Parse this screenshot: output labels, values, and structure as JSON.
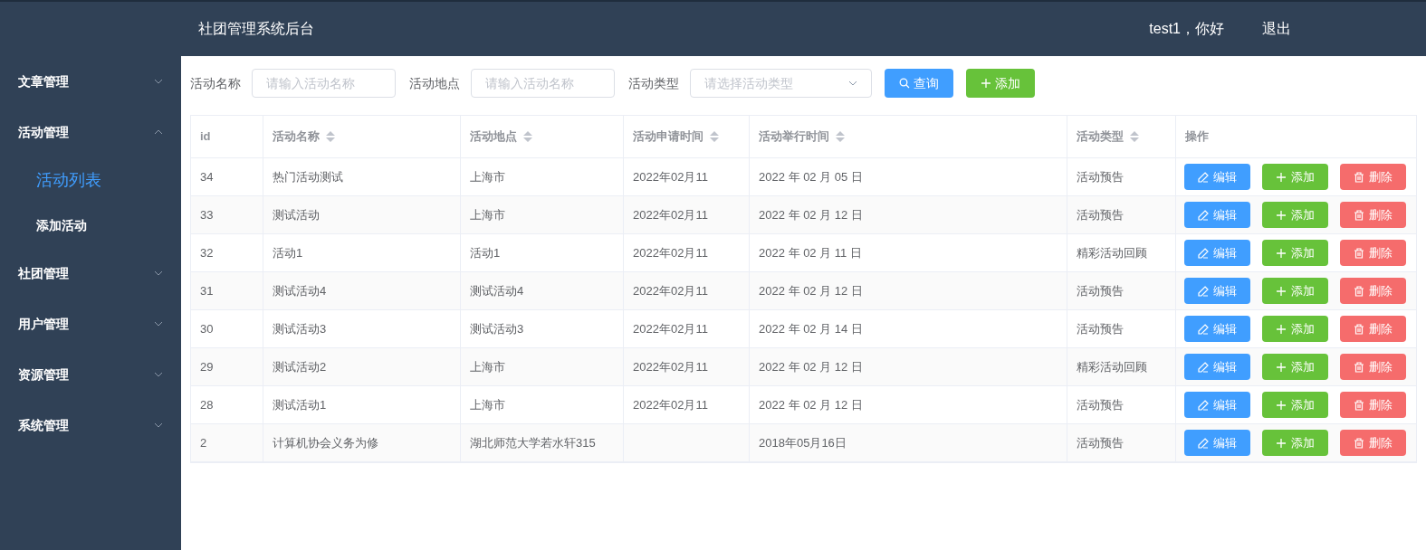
{
  "header": {
    "title": "社团管理系统后台",
    "greeting": "test1，你好",
    "logout": "退出"
  },
  "sidebar": {
    "items": [
      {
        "label": "文章管理",
        "expanded": false
      },
      {
        "label": "活动管理",
        "expanded": true,
        "children": [
          {
            "label": "活动列表",
            "selected": true
          },
          {
            "label": "添加活动",
            "selected": false
          }
        ]
      },
      {
        "label": "社团管理",
        "expanded": false
      },
      {
        "label": "用户管理",
        "expanded": false
      },
      {
        "label": "资源管理",
        "expanded": false
      },
      {
        "label": "系统管理",
        "expanded": false
      }
    ]
  },
  "filters": [
    {
      "kind": "input",
      "label": "活动名称",
      "placeholder": "请输入活动名称"
    },
    {
      "kind": "input",
      "label": "活动地点",
      "placeholder": "请输入活动名称"
    },
    {
      "kind": "select",
      "label": "活动类型",
      "placeholder": "请选择活动类型"
    }
  ],
  "toolbar_buttons": [
    {
      "kind": "search",
      "label": "查询"
    },
    {
      "kind": "add",
      "label": "添加"
    }
  ],
  "table": {
    "columns": [
      {
        "label": "id",
        "sortable": false
      },
      {
        "label": "活动名称",
        "sortable": true
      },
      {
        "label": "活动地点",
        "sortable": true
      },
      {
        "label": "活动申请时间",
        "sortable": true
      },
      {
        "label": "活动举行时间",
        "sortable": true
      },
      {
        "label": "活动类型",
        "sortable": true
      },
      {
        "label": "操作",
        "sortable": false
      }
    ],
    "rows": [
      {
        "cells": [
          "34",
          "热门活动测试",
          "上海市",
          "2022年02月11",
          "2022 年 02 月 05 日",
          "活动预告"
        ],
        "actions": [
          {
            "kind": "edit",
            "label": "编辑"
          },
          {
            "kind": "add",
            "label": "添加"
          },
          {
            "kind": "delete",
            "label": "删除"
          }
        ]
      },
      {
        "cells": [
          "33",
          "测试活动",
          "上海市",
          "2022年02月11",
          "2022 年 02 月 12 日",
          "活动预告"
        ],
        "actions": [
          {
            "kind": "edit",
            "label": "编辑"
          },
          {
            "kind": "add",
            "label": "添加"
          },
          {
            "kind": "delete",
            "label": "删除"
          }
        ]
      },
      {
        "cells": [
          "32",
          "活动1",
          "活动1",
          "2022年02月11",
          "2022 年 02 月 11 日",
          "精彩活动回顾"
        ],
        "actions": [
          {
            "kind": "edit",
            "label": "编辑"
          },
          {
            "kind": "add",
            "label": "添加"
          },
          {
            "kind": "delete",
            "label": "删除"
          }
        ]
      },
      {
        "cells": [
          "31",
          "测试活动4",
          "测试活动4",
          "2022年02月11",
          "2022 年 02 月 12 日",
          "活动预告"
        ],
        "actions": [
          {
            "kind": "edit",
            "label": "编辑"
          },
          {
            "kind": "add",
            "label": "添加"
          },
          {
            "kind": "delete",
            "label": "删除"
          }
        ]
      },
      {
        "cells": [
          "30",
          "测试活动3",
          "测试活动3",
          "2022年02月11",
          "2022 年 02 月 14 日",
          "活动预告"
        ],
        "actions": [
          {
            "kind": "edit",
            "label": "编辑"
          },
          {
            "kind": "add",
            "label": "添加"
          },
          {
            "kind": "delete",
            "label": "删除"
          }
        ]
      },
      {
        "cells": [
          "29",
          "测试活动2",
          "上海市",
          "2022年02月11",
          "2022 年 02 月 12 日",
          "精彩活动回顾"
        ],
        "actions": [
          {
            "kind": "edit",
            "label": "编辑"
          },
          {
            "kind": "add",
            "label": "添加"
          },
          {
            "kind": "delete",
            "label": "删除"
          }
        ]
      },
      {
        "cells": [
          "28",
          "测试活动1",
          "上海市",
          "2022年02月11",
          "2022 年 02 月 12 日",
          "活动预告"
        ],
        "actions": [
          {
            "kind": "edit",
            "label": "编辑"
          },
          {
            "kind": "add",
            "label": "添加"
          },
          {
            "kind": "delete",
            "label": "删除"
          }
        ]
      },
      {
        "cells": [
          "2",
          "计算机协会义务为修",
          "湖北师范大学若水轩315",
          null,
          "2018年05月16日",
          "活动预告"
        ],
        "actions": [
          {
            "kind": "edit",
            "label": "编辑"
          },
          {
            "kind": "add",
            "label": "添加"
          },
          {
            "kind": "delete",
            "label": "删除"
          }
        ]
      }
    ]
  }
}
